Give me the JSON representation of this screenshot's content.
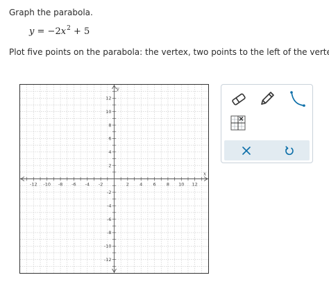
{
  "question": {
    "prompt": "Graph the parabola.",
    "equation": {
      "lhs": "y",
      "eq": "=",
      "sign": "−",
      "coef": "2",
      "var": "x",
      "exp": "2",
      "plus": "+",
      "const": "5"
    },
    "instructions": "Plot five points on the parabola: the vertex, two points to the left of the vertex, and two"
  },
  "graph": {
    "x_axis_label": "x",
    "y_axis_label": "y",
    "x_ticks": [
      "-12",
      "-10",
      "-8",
      "-6",
      "-4",
      "-2",
      "2",
      "4",
      "6",
      "8",
      "10",
      "12"
    ],
    "y_ticks": [
      "12",
      "10",
      "8",
      "6",
      "4",
      "2",
      "-2",
      "-4",
      "-6",
      "-8",
      "-10",
      "-12"
    ],
    "range": [
      -14,
      14
    ],
    "grid": true,
    "grid_color": "#c8c8c8",
    "axis_color": "#555555"
  },
  "toolbox": {
    "tools": [
      {
        "name": "eraser",
        "icon": "eraser-icon"
      },
      {
        "name": "pencil",
        "icon": "pencil-icon"
      },
      {
        "name": "parabola",
        "icon": "parabola-icon"
      },
      {
        "name": "no-solution",
        "icon": "no-solution-icon"
      }
    ],
    "actions": [
      {
        "name": "clear",
        "icon": "close-icon"
      },
      {
        "name": "undo",
        "icon": "undo-icon"
      }
    ],
    "accent_color": "#0b6ea8",
    "action_bar_color": "#e2ebf1"
  }
}
